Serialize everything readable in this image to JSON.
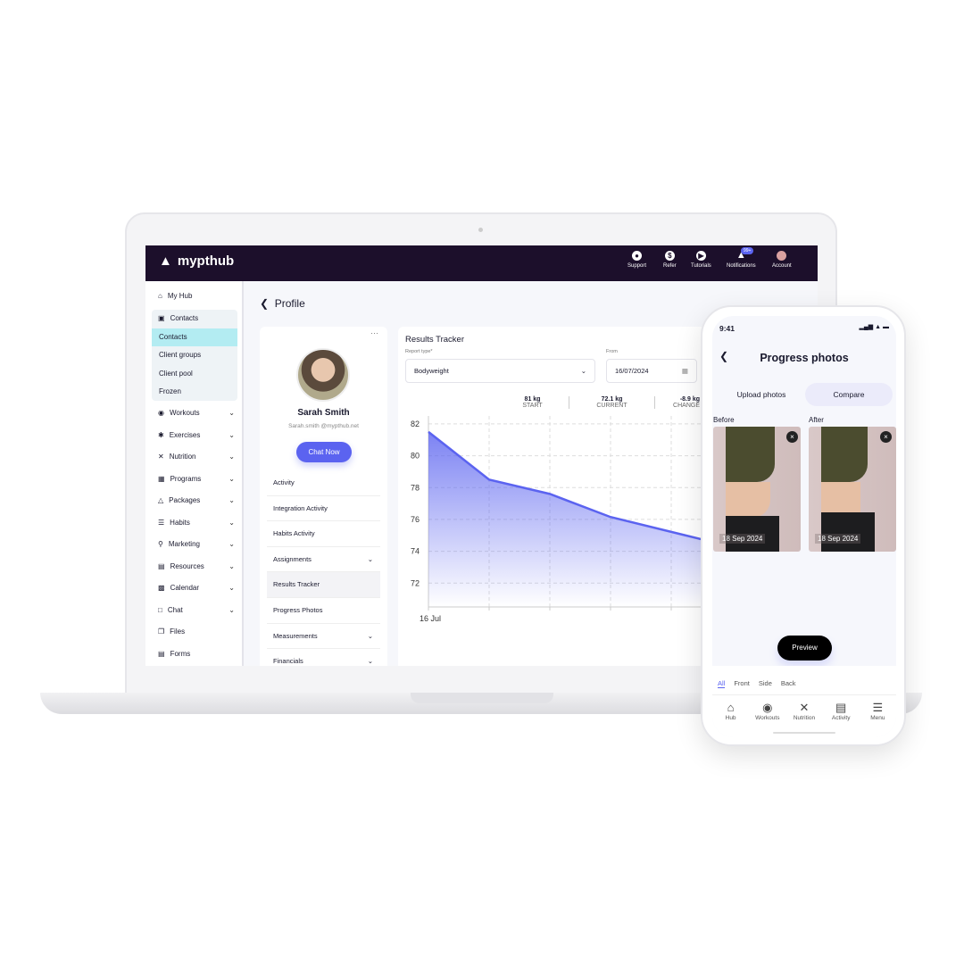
{
  "app": {
    "brand": "mypthub",
    "accent": "#5b63f0",
    "topbar_color": "#1c0f2b"
  },
  "topbar": {
    "items": [
      {
        "label": "Support",
        "icon": "headset-icon"
      },
      {
        "label": "Refer",
        "icon": "dollar-icon"
      },
      {
        "label": "Tutorials",
        "icon": "play-icon"
      },
      {
        "label": "Notifications",
        "icon": "bell-icon"
      },
      {
        "label": "Account",
        "icon": "avatar-icon"
      }
    ],
    "notification_badge": "99+"
  },
  "sidebar": {
    "items": [
      {
        "label": "My Hub",
        "icon": "home-icon"
      },
      {
        "label": "Contacts",
        "icon": "contacts-icon",
        "sub": [
          "Contacts",
          "Client groups",
          "Client pool",
          "Frozen"
        ]
      },
      {
        "label": "Workouts",
        "icon": "workouts-icon",
        "chevron": true
      },
      {
        "label": "Exercises",
        "icon": "run-icon",
        "chevron": true
      },
      {
        "label": "Nutrition",
        "icon": "fork-icon",
        "chevron": true
      },
      {
        "label": "Programs",
        "icon": "calendar-grid-icon",
        "chevron": true
      },
      {
        "label": "Packages",
        "icon": "package-icon",
        "chevron": true
      },
      {
        "label": "Habits",
        "icon": "list-icon",
        "chevron": true
      },
      {
        "label": "Marketing",
        "icon": "search-icon",
        "chevron": true
      },
      {
        "label": "Resources",
        "icon": "archive-icon",
        "chevron": true
      },
      {
        "label": "Calendar",
        "icon": "calendar-icon",
        "chevron": true
      },
      {
        "label": "Chat",
        "icon": "chat-icon",
        "chevron": true
      },
      {
        "label": "Files",
        "icon": "files-icon"
      },
      {
        "label": "Forms",
        "icon": "forms-icon"
      }
    ]
  },
  "page": {
    "title": "Profile"
  },
  "profile": {
    "name": "Sarah Smith",
    "email": "Sarah.smith @mypthub.net",
    "chat_button": "Chat Now",
    "menu": [
      "Activity",
      "Integration Activity",
      "Habits Activity",
      "Assignments",
      "Results Tracker",
      "Progress Photos",
      "Measurements",
      "Financials"
    ],
    "expandable": [
      "Assignments",
      "Measurements",
      "Financials"
    ],
    "active": "Results Tracker"
  },
  "tracker": {
    "title": "Results Tracker",
    "report_label": "Report type*",
    "report_value": "Bodyweight",
    "from_label": "From",
    "from_value": "16/07/2024",
    "stats": [
      {
        "value": "81 kg",
        "label": "START"
      },
      {
        "value": "72.1 kg",
        "label": "CURRENT"
      },
      {
        "value": "-8.9 kg",
        "label": "CHANGE"
      }
    ]
  },
  "chart_data": {
    "type": "area",
    "x_tick_labels": [
      "16 Jul"
    ],
    "y_ticks": [
      72,
      74,
      76,
      78,
      80,
      82
    ],
    "ylim": [
      70.5,
      82.5
    ],
    "grid": true,
    "color": "#5b63f0",
    "x": [
      0,
      1,
      2,
      3,
      4.5
    ],
    "values": [
      81.5,
      78.5,
      77.6,
      76.15,
      74.75
    ]
  },
  "phone": {
    "time": "9:41",
    "title": "Progress photos",
    "tabs": [
      "Upload photos",
      "Compare"
    ],
    "active_tab": "Compare",
    "before_label": "Before",
    "after_label": "After",
    "before_date": "18 Sep 2024",
    "after_date": "18 Sep 2024",
    "preview": "Preview",
    "filters": [
      "All",
      "Front",
      "Side",
      "Back"
    ],
    "active_filter": "All",
    "nav": [
      {
        "label": "Hub",
        "icon": "home-icon"
      },
      {
        "label": "Workouts",
        "icon": "workouts-icon"
      },
      {
        "label": "Nutrition",
        "icon": "fork-knife-icon"
      },
      {
        "label": "Activity",
        "icon": "activity-icon"
      },
      {
        "label": "Menu",
        "icon": "menu-icon"
      }
    ]
  }
}
